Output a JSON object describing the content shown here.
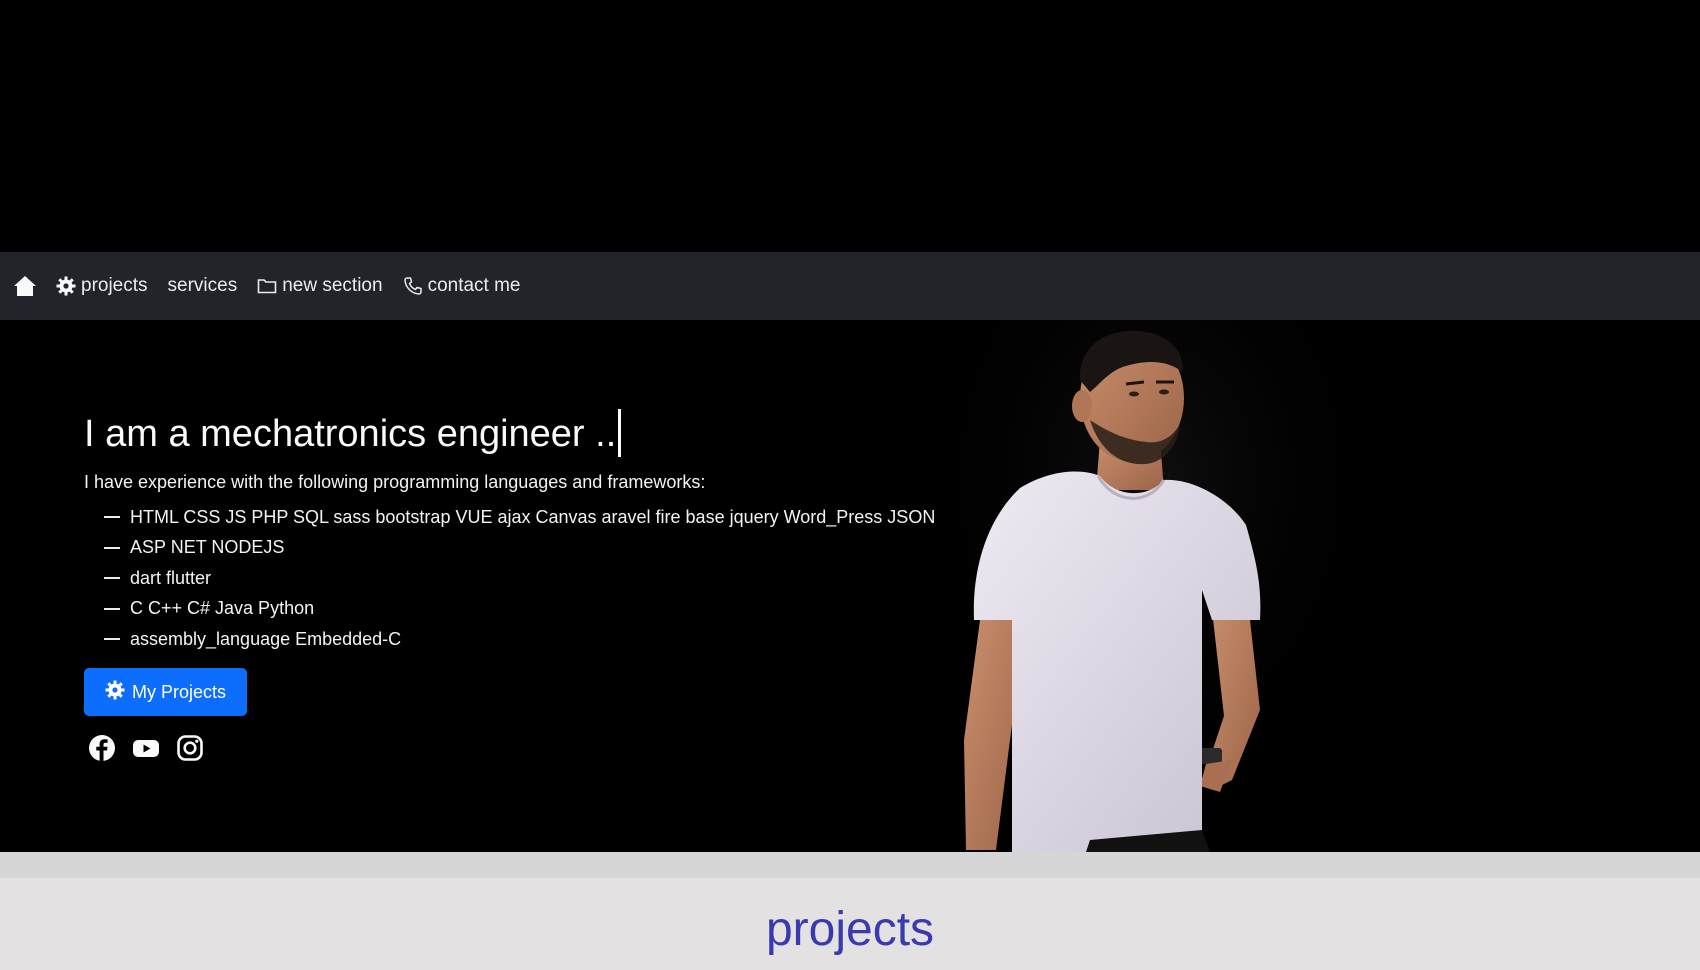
{
  "navbar": {
    "items": [
      {
        "label": "projects",
        "icon": "gear-icon"
      },
      {
        "label": "services",
        "icon": ""
      },
      {
        "label": "new section",
        "icon": "folder-icon"
      },
      {
        "label": "contact me",
        "icon": "phone-icon"
      }
    ]
  },
  "hero": {
    "title": "I am a mechatronics engineer ..",
    "intro": "I have experience with the following programming languages and frameworks:",
    "skills": [
      "HTML CSS JS PHP SQL sass bootstrap VUE ajax Canvas aravel fire base jquery Word_Press JSON",
      "ASP NET NODEJS",
      "dart flutter",
      "C C++ C# Java Python",
      "assembly_language Embedded-C"
    ],
    "button_label": "My Projects",
    "social_icons": [
      "facebook-icon",
      "youtube-icon",
      "instagram-icon"
    ]
  },
  "projects_section": {
    "heading": "projects"
  },
  "colors": {
    "navbar_bg": "#212529",
    "button_bg": "#0d6efd",
    "heading_color": "#3a3ab0",
    "section_bg": "#e3e1e1"
  }
}
